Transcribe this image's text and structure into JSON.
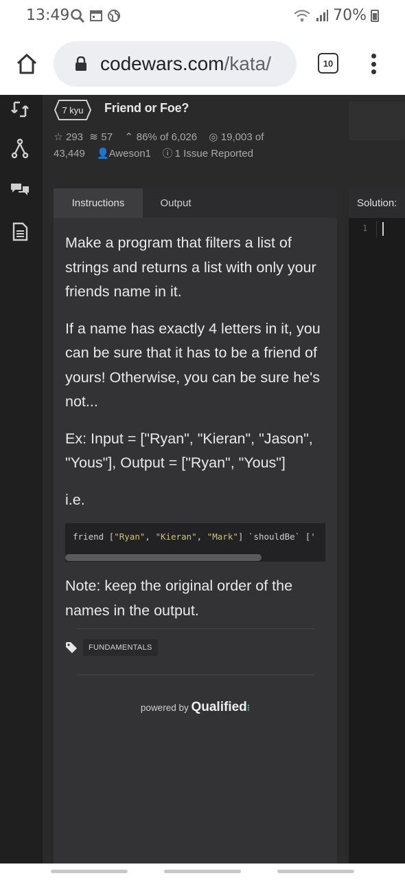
{
  "status_bar": {
    "time": "13:49",
    "battery": "70%"
  },
  "browser": {
    "url_host": "codewars.com",
    "url_path": "/kata/",
    "tab_count": "10"
  },
  "kata": {
    "rank": "7 kyu",
    "title": "Friend or Foe?",
    "stats": {
      "stars": "293",
      "collections": "57",
      "satisfaction": "86%",
      "satisfaction_of": "of 6,026",
      "completed": "19,003",
      "completed_of": "of",
      "completed_total": "43,449",
      "author": "Aweson1",
      "issues": "1 Issue Reported"
    }
  },
  "tabs": {
    "instructions": "Instructions",
    "output": "Output"
  },
  "description": {
    "p1": "Make a program that filters a list of strings and returns a list with only your friends name in it.",
    "p2": "If a name has exactly 4 letters in it, you can be sure that it has to be a friend of yours! Otherwise, you can be sure he's not...",
    "p3": "Ex: Input = [\"Ryan\", \"Kieran\", \"Jason\", \"Yous\"], Output = [\"Ryan\", \"Yous\"]",
    "p4": "i.e.",
    "code": {
      "fn": "friend [",
      "s1": "\"Ryan\"",
      "sep1": ", ",
      "s2": "\"Kieran\"",
      "sep2": ", ",
      "s3": "\"Mark\"",
      "rest": "] `shouldBe` ['"
    },
    "note": "Note: keep the original order of the names in the output."
  },
  "tag": "FUNDAMENTALS",
  "powered": {
    "prefix": "powered by",
    "brand": "Qualified"
  },
  "editor": {
    "label": "Solution:",
    "line_number": "1"
  },
  "colors": {
    "accent_green": "#2ec27e",
    "string_yellow": "#c9c27a",
    "panel_bg": "#333335"
  }
}
